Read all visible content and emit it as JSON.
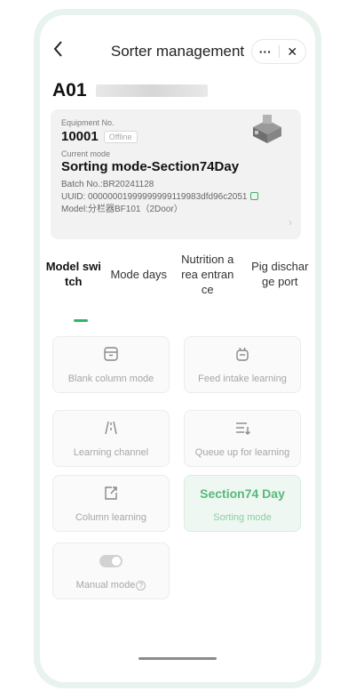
{
  "header": {
    "back_icon": "chevron-left-icon",
    "title": "Sorter management",
    "more_label": "···",
    "close_label": "✕"
  },
  "device": {
    "code": "A01"
  },
  "info": {
    "equipment_no_label": "Equipment No.",
    "equipment_no": "10001",
    "status": "Offline",
    "current_mode_label": "Current mode",
    "current_mode": "Sorting mode-Section74Day",
    "batch": "Batch No.:BR20241128",
    "uuid": "UUID:  00000001999999999119983dfd96c2051",
    "model": "Model:分栏器BF101（2Door）",
    "chevron": "›"
  },
  "tabs": [
    {
      "label": "Model swi tch",
      "active": true
    },
    {
      "label": "Mode days",
      "active": false
    },
    {
      "label": "Nutrition a rea entran ce",
      "active": false
    },
    {
      "label": "Pig dischar ge port",
      "active": false
    }
  ],
  "modes": {
    "blank_column": "Blank column mode",
    "feed_intake": "Feed intake learning",
    "learning_channel": "Learning channel",
    "queue_up": "Queue up for learning",
    "column_learning": "Column learning",
    "section_title": "Section74 Day",
    "sorting_mode": "Sorting mode",
    "manual_mode": "Manual mode",
    "help_glyph": "?"
  },
  "colors": {
    "accent": "#2fb46a",
    "highlight_text": "#57b97b",
    "frame": "#e9f3ee"
  }
}
